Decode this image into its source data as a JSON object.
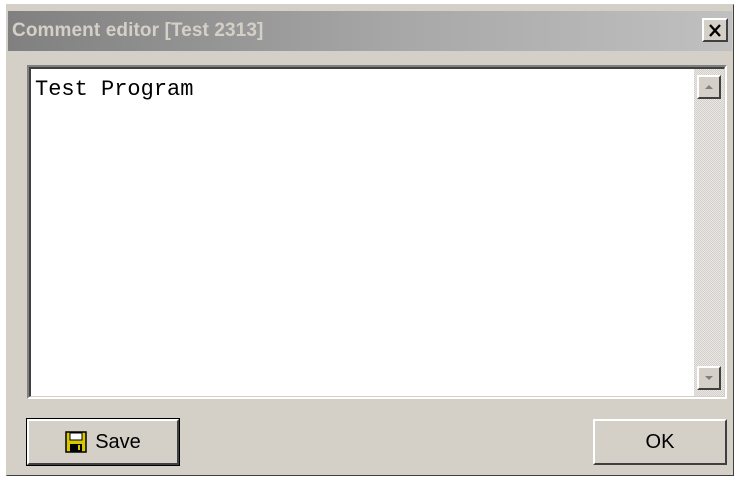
{
  "window": {
    "title": "Comment editor [Test 2313]",
    "close_icon": "close-x-icon"
  },
  "editor": {
    "text": "Test Program",
    "scroll_up_icon": "arrow-up-icon",
    "scroll_down_icon": "arrow-down-icon"
  },
  "buttons": {
    "save_label": "Save",
    "save_icon": "floppy-disk-icon",
    "ok_label": "OK"
  },
  "colors": {
    "window_bg": "#d4d0c8",
    "title_gradient_start": "#808080",
    "title_text": "#d4d0c8",
    "editor_bg": "#ffffff",
    "save_icon_fill": "#d8c800"
  }
}
